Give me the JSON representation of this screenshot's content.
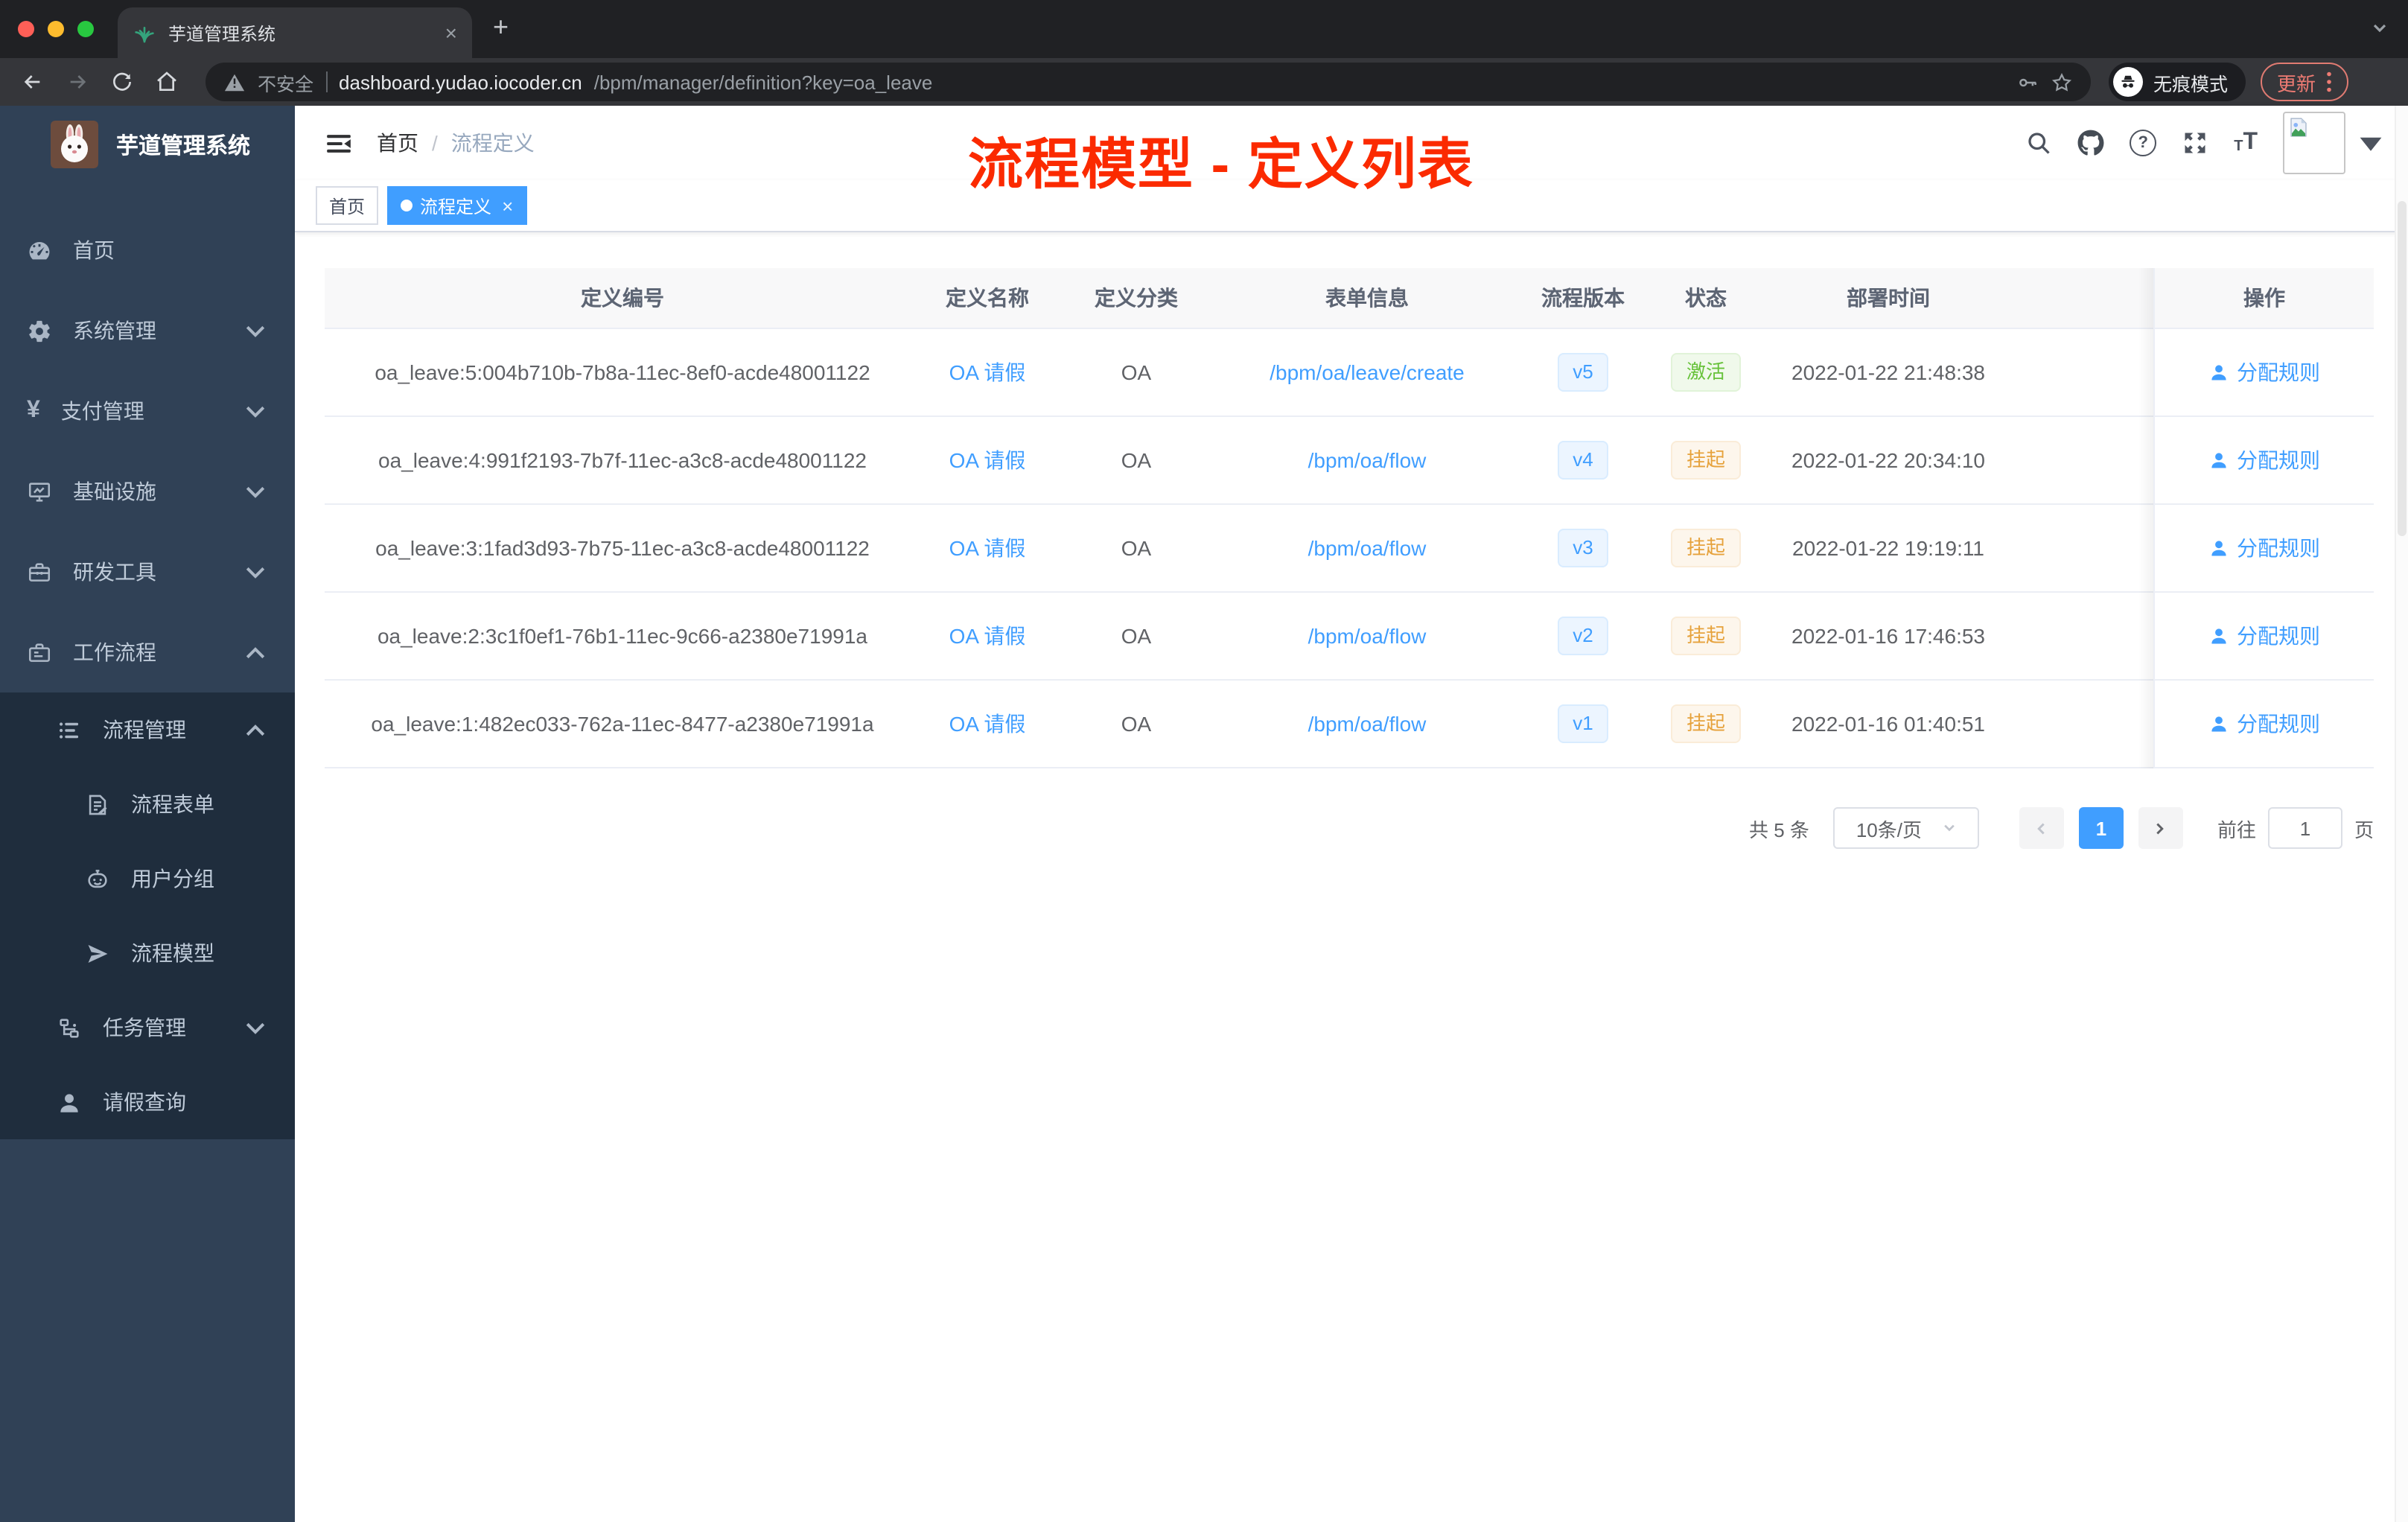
{
  "browser": {
    "tab_title": "芋道管理系统",
    "security_label": "不安全",
    "url_host": "dashboard.yudao.iocoder.cn",
    "url_path": "/bpm/manager/definition?key=oa_leave",
    "incognito_label": "无痕模式",
    "update_label": "更新"
  },
  "sidebar": {
    "app_title": "芋道管理系统",
    "items": [
      {
        "key": "home",
        "label": "首页",
        "icon": "dashboard",
        "level": 1,
        "chevron": null,
        "dark": false
      },
      {
        "key": "system",
        "label": "系统管理",
        "icon": "gear",
        "level": 1,
        "chevron": "down",
        "dark": false
      },
      {
        "key": "payment",
        "label": "支付管理",
        "icon": "yen",
        "level": 1,
        "chevron": "down",
        "dark": false
      },
      {
        "key": "infra",
        "label": "基础设施",
        "icon": "monitor",
        "level": 1,
        "chevron": "down",
        "dark": false
      },
      {
        "key": "devtools",
        "label": "研发工具",
        "icon": "toolbox",
        "level": 1,
        "chevron": "down",
        "dark": false
      },
      {
        "key": "workflow",
        "label": "工作流程",
        "icon": "briefcase",
        "level": 1,
        "chevron": "up",
        "dark": false
      },
      {
        "key": "process-manage",
        "label": "流程管理",
        "icon": "list",
        "level": 2,
        "chevron": "up",
        "dark": true
      },
      {
        "key": "process-form",
        "label": "流程表单",
        "icon": "form",
        "level": 3,
        "chevron": null,
        "dark": true
      },
      {
        "key": "user-group",
        "label": "用户分组",
        "icon": "robot",
        "level": 3,
        "chevron": null,
        "dark": true
      },
      {
        "key": "process-model",
        "label": "流程模型",
        "icon": "send",
        "level": 3,
        "chevron": null,
        "dark": true
      },
      {
        "key": "task-manage",
        "label": "任务管理",
        "icon": "tree",
        "level": 2,
        "chevron": "down",
        "dark": true
      },
      {
        "key": "leave-query",
        "label": "请假查询",
        "icon": "user",
        "level": 2,
        "chevron": null,
        "dark": true
      }
    ]
  },
  "navbar": {
    "breadcrumb_home": "首页",
    "breadcrumb_current": "流程定义"
  },
  "annotation": {
    "text": "流程模型 - 定义列表",
    "color": "#fb2a00"
  },
  "tags": [
    {
      "label": "首页",
      "active": false,
      "closable": false
    },
    {
      "label": "流程定义",
      "active": true,
      "closable": true
    }
  ],
  "table": {
    "columns": [
      {
        "key": "id",
        "label": "定义编号"
      },
      {
        "key": "name",
        "label": "定义名称"
      },
      {
        "key": "category",
        "label": "定义分类"
      },
      {
        "key": "form",
        "label": "表单信息"
      },
      {
        "key": "version",
        "label": "流程版本"
      },
      {
        "key": "status",
        "label": "状态"
      },
      {
        "key": "time",
        "label": "部署时间"
      },
      {
        "key": "action",
        "label": "操作"
      }
    ],
    "rows": [
      {
        "id": "oa_leave:5:004b710b-7b8a-11ec-8ef0-acde48001122",
        "name": "OA 请假",
        "category": "OA",
        "form": "/bpm/oa/leave/create",
        "version": "v5",
        "status": "激活",
        "status_type": "success",
        "time": "2022-01-22 21:48:38",
        "action": "分配规则"
      },
      {
        "id": "oa_leave:4:991f2193-7b7f-11ec-a3c8-acde48001122",
        "name": "OA 请假",
        "category": "OA",
        "form": "/bpm/oa/flow",
        "version": "v4",
        "status": "挂起",
        "status_type": "warning",
        "time": "2022-01-22 20:34:10",
        "action": "分配规则"
      },
      {
        "id": "oa_leave:3:1fad3d93-7b75-11ec-a3c8-acde48001122",
        "name": "OA 请假",
        "category": "OA",
        "form": "/bpm/oa/flow",
        "version": "v3",
        "status": "挂起",
        "status_type": "warning",
        "time": "2022-01-22 19:19:11",
        "action": "分配规则"
      },
      {
        "id": "oa_leave:2:3c1f0ef1-76b1-11ec-9c66-a2380e71991a",
        "name": "OA 请假",
        "category": "OA",
        "form": "/bpm/oa/flow",
        "version": "v2",
        "status": "挂起",
        "status_type": "warning",
        "time": "2022-01-16 17:46:53",
        "action": "分配规则"
      },
      {
        "id": "oa_leave:1:482ec033-762a-11ec-8477-a2380e71991a",
        "name": "OA 请假",
        "category": "OA",
        "form": "/bpm/oa/flow",
        "version": "v1",
        "status": "挂起",
        "status_type": "warning",
        "time": "2022-01-16 01:40:51",
        "action": "分配规则"
      }
    ]
  },
  "pagination": {
    "total_label": "共 5 条",
    "page_size_label": "10条/页",
    "current_page": "1",
    "goto_label": "前往",
    "goto_value": "1",
    "unit_label": "页"
  },
  "colors": {
    "accent": "#409eff",
    "sidebar_bg": "#304156",
    "submenu_bg": "#1f2d3d",
    "success": "#67c23a",
    "warning": "#e6a23c",
    "annotation_red": "#fb2a00"
  }
}
